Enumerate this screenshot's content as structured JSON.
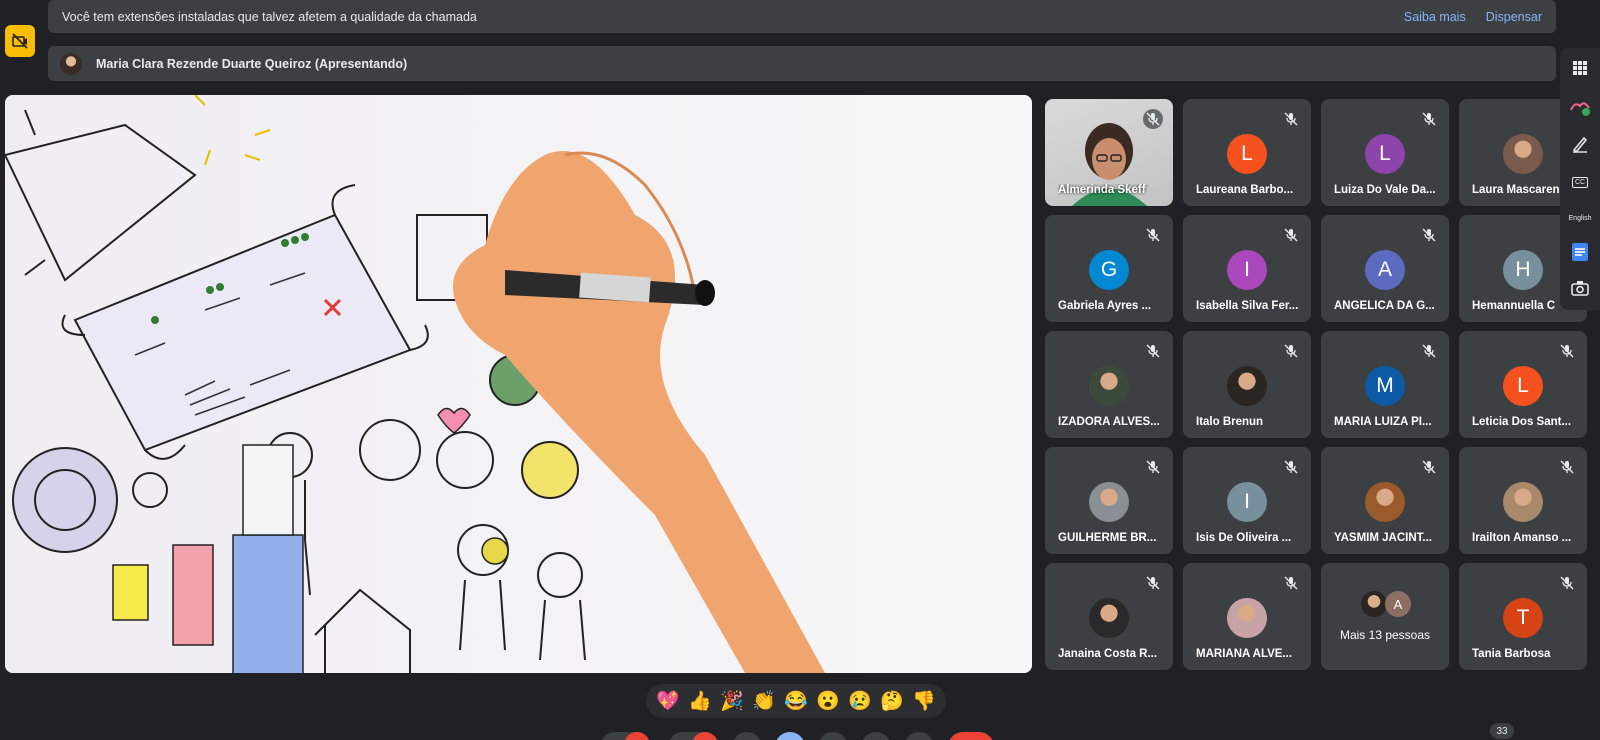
{
  "notification": {
    "text": "Você tem extensões instaladas que talvez afetem a qualidade da chamada",
    "learn_more": "Saiba mais",
    "dismiss": "Dispensar"
  },
  "presenter": {
    "label": "Maria Clara Rezende Duarte Queiroz (Apresentando)"
  },
  "presentation_icons": {
    "warning": "extension-warning-icon"
  },
  "participants": [
    {
      "name": "Almerinda Skeff",
      "initial": "",
      "color": "",
      "type": "video"
    },
    {
      "name": "Laureana Barbo...",
      "initial": "L",
      "color": "#f4511e",
      "type": "initial"
    },
    {
      "name": "Luiza Do Vale Da...",
      "initial": "L",
      "color": "#8e44ad",
      "type": "initial"
    },
    {
      "name": "Laura Mascaren",
      "initial": "",
      "color": "#7a5a4b",
      "type": "photo"
    },
    {
      "name": "Gabriela Ayres ...",
      "initial": "G",
      "color": "#0288d1",
      "type": "initial"
    },
    {
      "name": "Isabella Silva Fer...",
      "initial": "I",
      "color": "#ab47bc",
      "type": "initial"
    },
    {
      "name": "ANGÉLICA DA G...",
      "initial": "A",
      "color": "#5c6bc0",
      "type": "initial"
    },
    {
      "name": "Hemannuella C",
      "initial": "H",
      "color": "#78909c",
      "type": "initial"
    },
    {
      "name": "IZADORA ALVES...",
      "initial": "",
      "color": "#3b4a3a",
      "type": "photo"
    },
    {
      "name": "Ítalo Brenun",
      "initial": "",
      "color": "#2b2622",
      "type": "photo"
    },
    {
      "name": "MARIA LUIZA PI...",
      "initial": "M",
      "color": "#0d5aa7",
      "type": "initial"
    },
    {
      "name": "Leticia Dos Sant...",
      "initial": "L",
      "color": "#f4511e",
      "type": "initial"
    },
    {
      "name": "GUILHERME BR...",
      "initial": "",
      "color": "#8a8f96",
      "type": "photo"
    },
    {
      "name": "Isis De Oliveira ...",
      "initial": "I",
      "color": "#78909c",
      "type": "initial"
    },
    {
      "name": "YASMIM JACINT...",
      "initial": "",
      "color": "#9a5a2a",
      "type": "photo"
    },
    {
      "name": "Irailton Amanso ...",
      "initial": "",
      "color": "#a88a6a",
      "type": "photo"
    },
    {
      "name": "Janaina Costa R...",
      "initial": "",
      "color": "#2a2a2a",
      "type": "photo"
    },
    {
      "name": "MARIANA ALVE...",
      "initial": "",
      "color": "#c7a3a8",
      "type": "photo"
    },
    {
      "name": "Mais 13 pessoas",
      "initial": "A",
      "color": "#8d6e63",
      "type": "more"
    },
    {
      "name": "Tania Barbosa",
      "initial": "T",
      "color": "#d84315",
      "type": "initial"
    }
  ],
  "side_rail": {
    "captions": "CC",
    "language": "English"
  },
  "reactions": [
    "💖",
    "👍",
    "🎉",
    "👏",
    "😂",
    "😮",
    "😢",
    "🤔",
    "👎"
  ],
  "participant_count": "33"
}
